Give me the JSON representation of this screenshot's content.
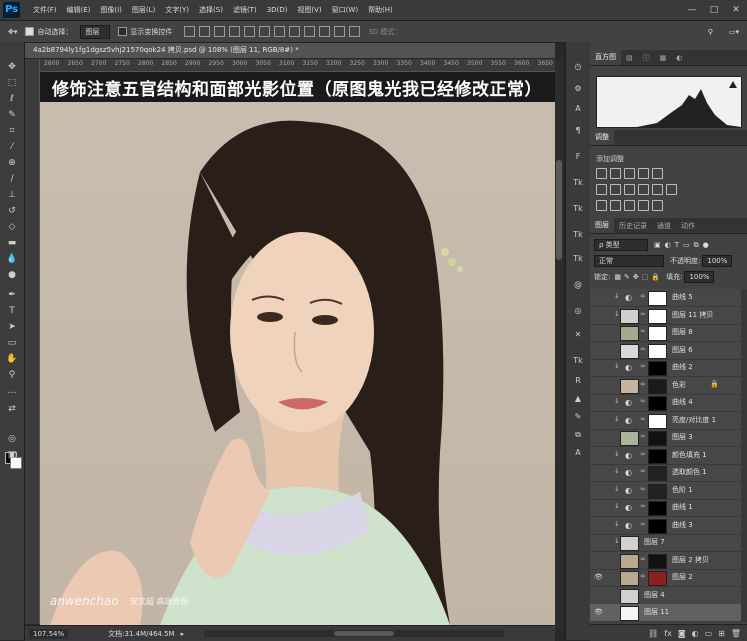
{
  "app": {
    "logo": "Ps"
  },
  "menubar": {
    "items": [
      "文件(F)",
      "编辑(E)",
      "图像(I)",
      "图层(L)",
      "文字(Y)",
      "选择(S)",
      "滤镜(T)",
      "3D(D)",
      "视图(V)",
      "窗口(W)",
      "帮助(H)"
    ],
    "window_controls": {
      "minimize": "—",
      "maximize": "□",
      "close": "✕"
    }
  },
  "options_bar": {
    "auto_select_label": "自动选择：",
    "auto_select_checked": true,
    "auto_select_target": "图层",
    "show_transform_label": "显示变换控件",
    "show_transform_checked": false,
    "mode_3d_label": "3D 模式："
  },
  "document": {
    "tab_title": "4a2b8794ly1fg1dgsz5vhj21570qok24 拷贝.psd @ 108% (图层 11, RGB/8#) *",
    "ruler_ticks": [
      "2600",
      "2650",
      "2700",
      "2750",
      "2800",
      "2850",
      "2900",
      "2950",
      "3000",
      "3050",
      "3100",
      "3150",
      "3200",
      "3250",
      "3300",
      "3350",
      "3400",
      "3450",
      "3500",
      "3550",
      "3600",
      "3650"
    ],
    "caption": "修饰注意五官结构和面部光影位置（原图鬼光我已经修改正常）",
    "watermark_en": "anwenchao",
    "watermark_cn": "安文超 高端修图"
  },
  "statusbar": {
    "zoom": "107.54%",
    "doc_size": "文档:31.4M/464.5M"
  },
  "panels": {
    "top_tabs": [
      "直方图",
      "",
      "",
      "",
      ""
    ],
    "adjust_tab": "调整",
    "adjust_label": "添加调整",
    "layers_tabs": [
      "图层",
      "历史记录",
      "通道",
      "动作"
    ],
    "filter_label": "ρ 类型",
    "blend_mode": "正常",
    "opacity_label": "不透明度:",
    "opacity_value": "100%",
    "lock_label": "锁定:",
    "fill_label": "填充:",
    "fill_value": "100%"
  },
  "layers": [
    {
      "name": "曲线 5",
      "type": "adj",
      "visible": false,
      "clipped": true,
      "thumb": "#5a5a5a",
      "mask": "#ffffff",
      "selected": false,
      "locked": false
    },
    {
      "name": "图层 11 拷贝",
      "type": "pixel",
      "visible": false,
      "clipped": true,
      "thumb": "#cfcfcf",
      "mask": "#ffffff",
      "selected": false,
      "locked": false
    },
    {
      "name": "图层 8",
      "type": "pixel",
      "visible": false,
      "clipped": false,
      "thumb": "#a6a98a",
      "mask": "#ffffff",
      "selected": false,
      "locked": false
    },
    {
      "name": "图层 6",
      "type": "pixel",
      "visible": false,
      "clipped": false,
      "thumb": "#d8d8d8",
      "mask": "#ffffff",
      "selected": false,
      "locked": false
    },
    {
      "name": "曲线 2",
      "type": "adj",
      "visible": false,
      "clipped": true,
      "thumb": "#5a5a5a",
      "mask": "#000000",
      "selected": false,
      "locked": false
    },
    {
      "name": "色彩",
      "type": "pixel",
      "visible": false,
      "clipped": false,
      "thumb": "#c8b49c",
      "mask": "#1a1a1a",
      "selected": false,
      "locked": true
    },
    {
      "name": "曲线 4",
      "type": "adj",
      "visible": false,
      "clipped": true,
      "thumb": "#5a5a5a",
      "mask": "#000000",
      "selected": false,
      "locked": false
    },
    {
      "name": "亮度/对比度 1",
      "type": "adj",
      "visible": false,
      "clipped": true,
      "thumb": "#5a5a5a",
      "mask": "#ffffff",
      "selected": false,
      "locked": false
    },
    {
      "name": "图层 3",
      "type": "pixel",
      "visible": false,
      "clipped": false,
      "thumb": "#a8b59a",
      "mask": "#111111",
      "selected": false,
      "locked": false
    },
    {
      "name": "颜色填充 1",
      "type": "adj",
      "visible": false,
      "clipped": true,
      "thumb": "#111111",
      "mask": "#000000",
      "selected": false,
      "locked": false
    },
    {
      "name": "选取颜色 1",
      "type": "adj",
      "visible": false,
      "clipped": true,
      "thumb": "#5a5a5a",
      "mask": "#222222",
      "selected": false,
      "locked": false
    },
    {
      "name": "色阶 1",
      "type": "adj",
      "visible": false,
      "clipped": true,
      "thumb": "#5a5a5a",
      "mask": "#222222",
      "selected": false,
      "locked": false
    },
    {
      "name": "曲线 1",
      "type": "adj",
      "visible": false,
      "clipped": true,
      "thumb": "#5a5a5a",
      "mask": "#000000",
      "selected": false,
      "locked": false
    },
    {
      "name": "曲线 3",
      "type": "adj",
      "visible": false,
      "clipped": true,
      "thumb": "#5a5a5a",
      "mask": "#000000",
      "selected": false,
      "locked": false
    },
    {
      "name": "图层 7",
      "type": "pixel",
      "visible": false,
      "clipped": true,
      "thumb": "#d0d0d0",
      "mask": "",
      "selected": false,
      "locked": false
    },
    {
      "name": "图层 2 拷贝",
      "type": "pixel",
      "visible": false,
      "clipped": false,
      "thumb": "#b7a88e",
      "mask": "#111111",
      "selected": false,
      "locked": false
    },
    {
      "name": "图层 2",
      "type": "pixel",
      "visible": true,
      "clipped": false,
      "thumb": "#b7a88e",
      "mask": "#8a2020",
      "selected": false,
      "locked": false
    },
    {
      "name": "图层 4",
      "type": "pixel",
      "visible": false,
      "clipped": false,
      "thumb": "#d0d0d0",
      "mask": "",
      "selected": false,
      "locked": false
    },
    {
      "name": "图层 11",
      "type": "pixel",
      "visible": true,
      "clipped": false,
      "thumb": "#f4f4f4",
      "mask": "",
      "selected": true,
      "locked": false
    }
  ]
}
